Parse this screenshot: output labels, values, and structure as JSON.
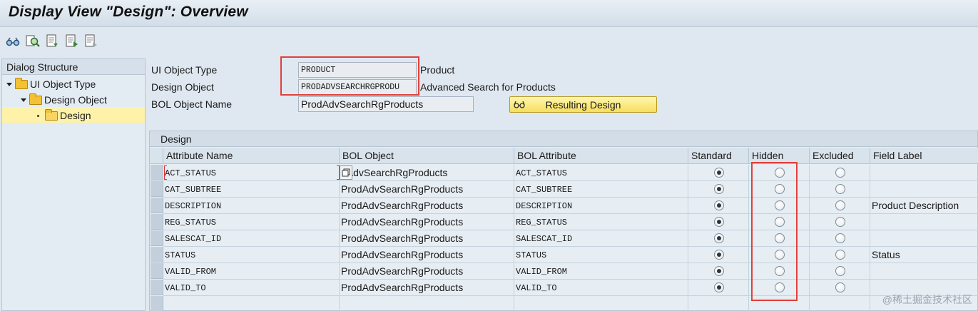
{
  "window": {
    "title": "Display View \"Design\": Overview"
  },
  "toolbar": {
    "icons": [
      "glasses-icon",
      "find-icon",
      "document-prev-icon",
      "document-next-icon",
      "document-detail-icon"
    ]
  },
  "tree": {
    "header": "Dialog Structure",
    "items": [
      {
        "label": "UI Object Type",
        "level": 0
      },
      {
        "label": "Design Object",
        "level": 1
      },
      {
        "label": "Design",
        "level": 2,
        "selected": true
      }
    ]
  },
  "fields": {
    "ui_object_type": {
      "label": "UI Object Type",
      "value": "PRODUCT",
      "description": "Product"
    },
    "design_object": {
      "label": "Design Object",
      "value": "PRODADVSEARCHRGPRODU",
      "description": "Advanced Search for Products"
    },
    "bol_object_name": {
      "label": "BOL Object Name",
      "value": "ProdAdvSearchRgProducts"
    }
  },
  "resulting_design_button": {
    "label": "Resulting Design"
  },
  "table": {
    "title": "Design",
    "columns": {
      "attribute_name": "Attribute Name",
      "bol_object": "BOL Object",
      "bol_attribute": "BOL Attribute",
      "standard": "Standard",
      "hidden": "Hidden",
      "excluded": "Excluded",
      "field_label": "Field Label"
    },
    "rows": [
      {
        "attribute_name": "ACT_STATUS",
        "bol_object": "dAdvSearchRgProducts",
        "bol_attribute": "ACT_STATUS",
        "selection": "standard",
        "field_label": ""
      },
      {
        "attribute_name": "CAT_SUBTREE",
        "bol_object": "ProdAdvSearchRgProducts",
        "bol_attribute": "CAT_SUBTREE",
        "selection": "standard",
        "field_label": ""
      },
      {
        "attribute_name": "DESCRIPTION",
        "bol_object": "ProdAdvSearchRgProducts",
        "bol_attribute": "DESCRIPTION",
        "selection": "standard",
        "field_label": "Product Description"
      },
      {
        "attribute_name": "REG_STATUS",
        "bol_object": "ProdAdvSearchRgProducts",
        "bol_attribute": "REG_STATUS",
        "selection": "standard",
        "field_label": ""
      },
      {
        "attribute_name": "SALESCAT_ID",
        "bol_object": "ProdAdvSearchRgProducts",
        "bol_attribute": "SALESCAT_ID",
        "selection": "standard",
        "field_label": ""
      },
      {
        "attribute_name": "STATUS",
        "bol_object": "ProdAdvSearchRgProducts",
        "bol_attribute": "STATUS",
        "selection": "standard",
        "field_label": "Status"
      },
      {
        "attribute_name": "VALID_FROM",
        "bol_object": "ProdAdvSearchRgProducts",
        "bol_attribute": "VALID_FROM",
        "selection": "standard",
        "field_label": ""
      },
      {
        "attribute_name": "VALID_TO",
        "bol_object": "ProdAdvSearchRgProducts",
        "bol_attribute": "VALID_TO",
        "selection": "standard",
        "field_label": ""
      }
    ]
  },
  "watermark": "@稀土掘金技术社区",
  "colors": {
    "highlight": "#e0403a",
    "selected_row": "#fdf2a8",
    "button": "#f6df5c"
  }
}
